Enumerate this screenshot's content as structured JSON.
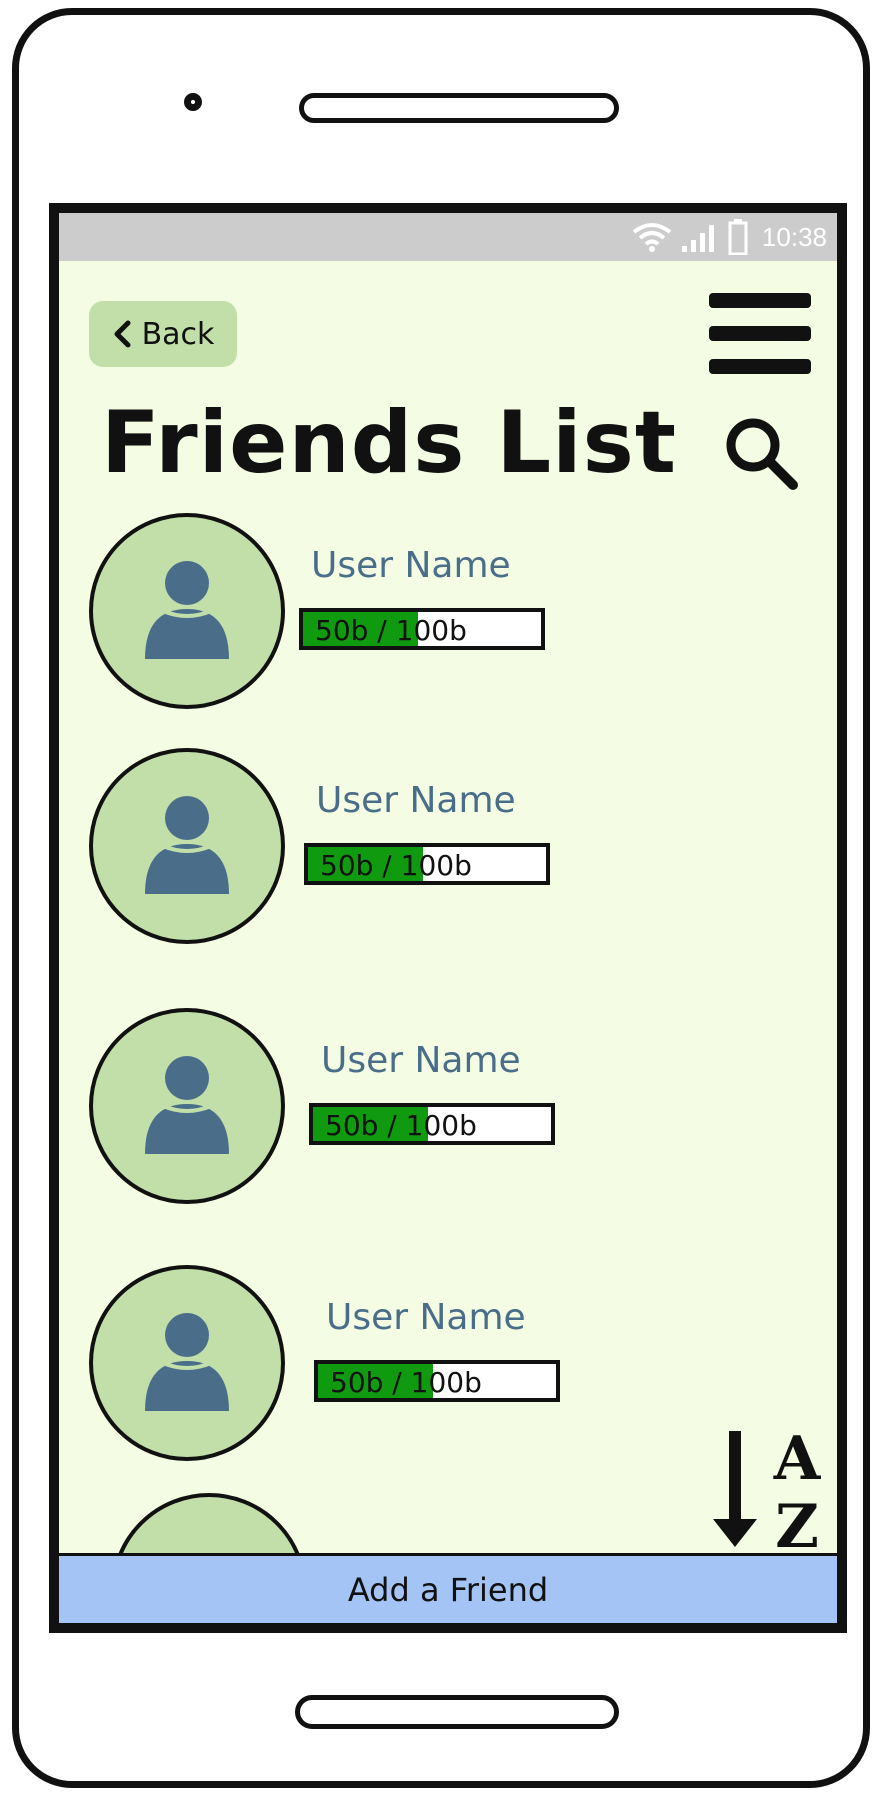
{
  "status_bar": {
    "time": "10:38",
    "icons": [
      "wifi-icon",
      "signal-icon",
      "battery-icon"
    ]
  },
  "header": {
    "back_label": "Back",
    "title": "Friends List"
  },
  "friends": [
    {
      "name": "User Name",
      "progress_label": "50b / 100b",
      "progress_fraction": 0.5
    },
    {
      "name": "User Name",
      "progress_label": "50b / 100b",
      "progress_fraction": 0.5
    },
    {
      "name": "User Name",
      "progress_label": "50b / 100b",
      "progress_fraction": 0.5
    },
    {
      "name": "User Name",
      "progress_label": "50b / 100b",
      "progress_fraction": 0.5
    }
  ],
  "sort": {
    "top": "A",
    "bottom": "Z"
  },
  "footer": {
    "add_friend_label": "Add a Friend"
  },
  "colors": {
    "screen_bg": "#f4fde3",
    "avatar_bg": "#c2dfaa",
    "avatar_figure": "#4a6e8a",
    "progress_fill": "#0f9a10",
    "add_friend_bar": "#a3c4f5",
    "status_bar": "#cccccc"
  }
}
